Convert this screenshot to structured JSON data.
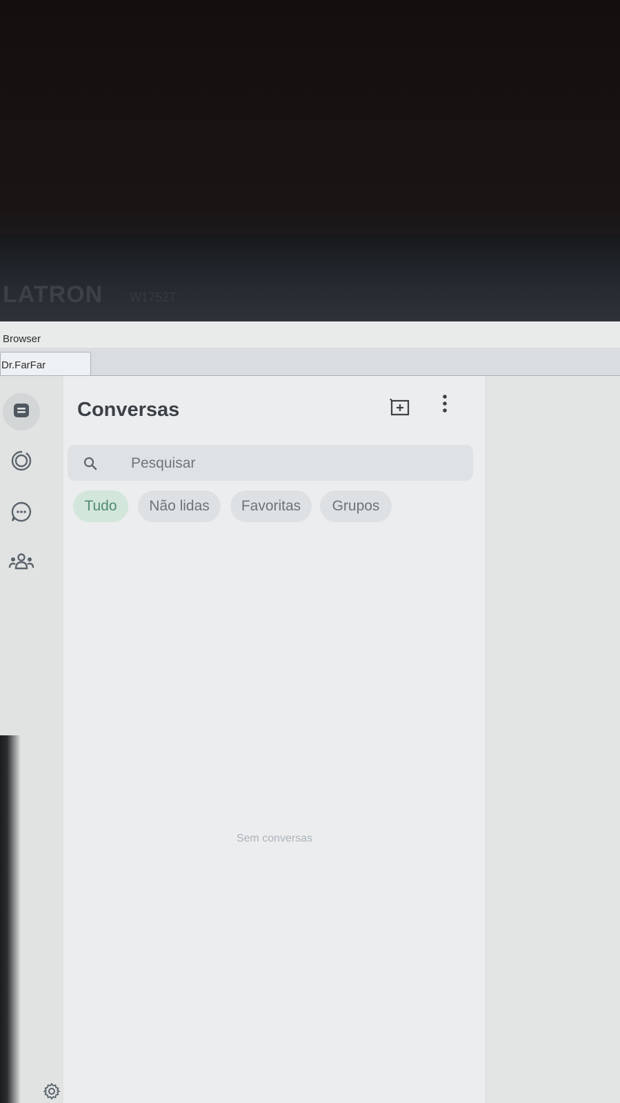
{
  "monitor": {
    "brand": "LATRON",
    "model": "W1752T"
  },
  "window": {
    "title": "Browser",
    "tab_label": "Dr.FarFar"
  },
  "rail": {
    "items": [
      {
        "icon": "chats-icon",
        "active": true
      },
      {
        "icon": "status-icon",
        "active": false
      },
      {
        "icon": "channels-icon",
        "active": false
      },
      {
        "icon": "communities-icon",
        "active": false
      }
    ],
    "settings_icon": "gear-icon"
  },
  "panel": {
    "title": "Conversas",
    "new_chat_icon": "new-chat-icon",
    "menu_icon": "kebab-menu-icon",
    "search": {
      "placeholder": "Pesquisar",
      "value": ""
    },
    "filters": [
      {
        "label": "Tudo",
        "active": true
      },
      {
        "label": "Não lidas",
        "active": false
      },
      {
        "label": "Favoritas",
        "active": false
      },
      {
        "label": "Grupos",
        "active": false
      }
    ],
    "empty_message": "Sem conversas"
  },
  "colors": {
    "accent": "#4f8a72",
    "accent_bg": "#d3e6dc",
    "title": "#3b4146",
    "chip_bg": "#dde1e3"
  }
}
